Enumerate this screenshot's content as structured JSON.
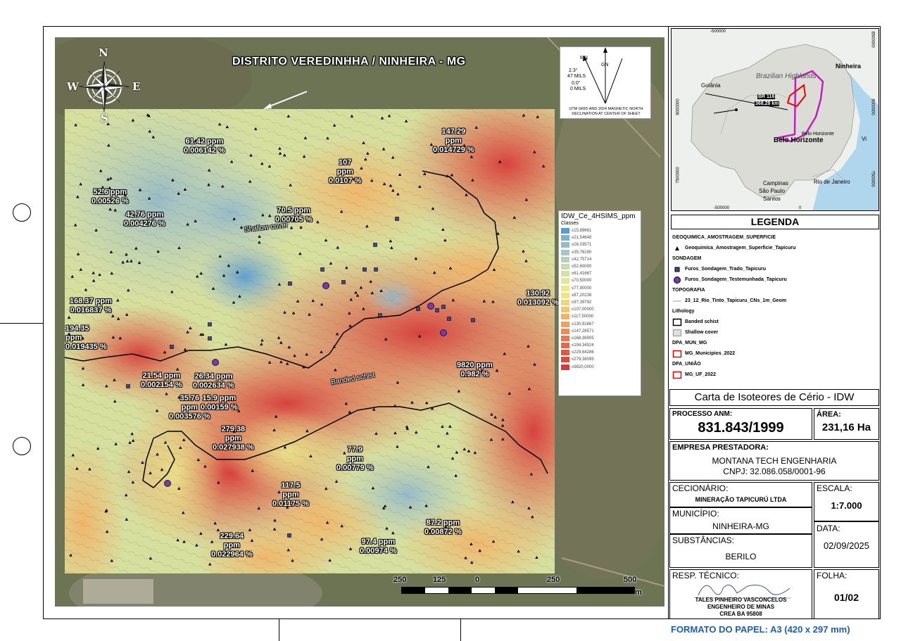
{
  "map": {
    "title": "DISTRITO VEREDINHHA / NINHEIRA - MG",
    "compass": {
      "n": "N",
      "s": "S",
      "e": "E",
      "w": "W"
    },
    "declination_text": [
      "UTM GRID AND 2024 MAGNETIC NORTH",
      "DECLINATION AT CENTER OF SHEET"
    ],
    "declination_marks": {
      "mn": "MN",
      "gn": "GN",
      "angle1": "2.3°",
      "mils": "47 MILS",
      "deg": "0.0°",
      "mils2": "0 MILS"
    },
    "geo_labels": [
      {
        "text": "Shallow cover"
      },
      {
        "text": "Banded schist"
      }
    ],
    "samples": [
      {
        "name": "61.42ppm",
        "lines": [
          "61.42 ppm",
          "0.006142 %"
        ]
      },
      {
        "name": "147.29ppm",
        "lines": [
          "147.29",
          "ppm",
          "0.014729 %"
        ]
      },
      {
        "name": "107ppm",
        "lines": [
          "107",
          "ppm",
          "0.0107 %"
        ]
      },
      {
        "name": "52.6ppm",
        "lines": [
          "52.6 ppm",
          "0.00526 %"
        ]
      },
      {
        "name": "42.76ppm",
        "lines": [
          "42.76 ppm",
          "0.004276 %"
        ]
      },
      {
        "name": "70.5ppm",
        "lines": [
          "70.5 ppm",
          "0.00705 %"
        ]
      },
      {
        "name": "168.37ppm",
        "lines": [
          "168.37 ppm",
          "0.016837 %"
        ]
      },
      {
        "name": "130.92ppm",
        "lines": [
          "130.92",
          "0.013092 %"
        ]
      },
      {
        "name": "194.35ppm",
        "lines": [
          "194.35",
          "ppm",
          "0.019435 %"
        ]
      },
      {
        "name": "9820ppm",
        "lines": [
          "9820 ppm",
          "0.982 %"
        ]
      },
      {
        "name": "21.54ppm",
        "lines": [
          "21.54 ppm",
          "0.002154 %"
        ]
      },
      {
        "name": "26.34ppm",
        "lines": [
          "26.34 ppm",
          "0.002634 %"
        ]
      },
      {
        "name": "35.76ppm",
        "lines": [
          "35.76",
          "ppm",
          "0.003576 %"
        ]
      },
      {
        "name": "15.9ppm",
        "lines": [
          "15.9 ppm",
          "0.00159 %"
        ]
      },
      {
        "name": "279.38ppm",
        "lines": [
          "279.38",
          "ppm",
          "0.027938 %"
        ]
      },
      {
        "name": "77.9ppm",
        "lines": [
          "77.9",
          "ppm",
          "0.00779 %"
        ]
      },
      {
        "name": "117.5ppm",
        "lines": [
          "117.5",
          "ppm",
          "0.01175 %"
        ]
      },
      {
        "name": "87.2ppm",
        "lines": [
          "87.2 ppm",
          "0.00872 %"
        ]
      },
      {
        "name": "229.64ppm",
        "lines": [
          "229.64",
          "ppm",
          "0.022964 %"
        ]
      },
      {
        "name": "97.4ppm",
        "lines": [
          "97.4 ppm",
          "0.00974 %"
        ]
      }
    ],
    "idw_legend": {
      "title": "IDW_Ce_4HSIMS_ppm",
      "subtitle": "Classes",
      "classes": [
        {
          "label": "≤15,89661",
          "color": "#5a9bd4"
        },
        {
          "label": "≤21,54648",
          "color": "#7fb0d2"
        },
        {
          "label": "≤26,03571",
          "color": "#95bccc"
        },
        {
          "label": "≤35,76190",
          "color": "#a8c6c6"
        },
        {
          "label": "≤42,75714",
          "color": "#b9d0bd"
        },
        {
          "label": "≤52,60000",
          "color": "#c9d9b2"
        },
        {
          "label": "≤61,41667",
          "color": "#d6e0a6"
        },
        {
          "label": "≤70,50000",
          "color": "#e2e698"
        },
        {
          "label": "≤77,90000",
          "color": "#ebe88c"
        },
        {
          "label": "≤87,20238",
          "color": "#f1e382"
        },
        {
          "label": "≤97,39792",
          "color": "#f3d679"
        },
        {
          "label": "≤107,00000",
          "color": "#f4c56f"
        },
        {
          "label": "≤117,50000",
          "color": "#f3b266"
        },
        {
          "label": "≤130,91667",
          "color": "#f09f5e"
        },
        {
          "label": "≤147,28571",
          "color": "#ec8c56"
        },
        {
          "label": "≤168,36905",
          "color": "#e87a4f"
        },
        {
          "label": "≤194,34524",
          "color": "#e46849"
        },
        {
          "label": "≤229,64286",
          "color": "#e05743"
        },
        {
          "label": "≤279,38095",
          "color": "#dc493e"
        },
        {
          "label": "≤9820,0000",
          "color": "#d83a39"
        }
      ]
    },
    "scale": {
      "ticks": [
        "250",
        "125",
        "0",
        "250",
        "500"
      ],
      "unit": "m"
    }
  },
  "inset": {
    "labels": {
      "ninheira": "Ninheira",
      "brazilian": "Brazilian Highlands",
      "goiania": "Goiânia",
      "br116": "BR 116",
      "dist": "368,28 km",
      "bh_small": "Belo Horizonte",
      "bh": "Belo Horizonte",
      "campinas": "Campinas",
      "sp": "São Paulo",
      "rio": "Rio de Janeiro",
      "santos": "Santos",
      "vi": "Vi"
    },
    "grid": {
      "top_left": "-500000",
      "top_right": "500000",
      "bottom_left": "-500000",
      "bottom_mid": "0",
      "left_mid": "8000000",
      "left_low": "7500000",
      "right_top": "8500000",
      "right_mid": "8000000",
      "right_low": "7500000"
    }
  },
  "legend": {
    "title": "LEGENDA",
    "groups": [
      {
        "head": "GEOQUIMICA_AMOSTRAGEM_SUPERFICIE",
        "items": [
          {
            "sym": "triangle",
            "text": "Geoquimica_Amostragem_Superficie_Tapicuru"
          }
        ]
      },
      {
        "head": "SONDAGEM",
        "items": [
          {
            "sym": "square",
            "text": "Furos_Sondagem_Trado_Tapicuru"
          },
          {
            "sym": "circle",
            "text": "Furos_Sondagem_Testemunhada_Tapicuru"
          }
        ]
      },
      {
        "head": "TOPOGRAFIA",
        "items": [
          {
            "sym": "line",
            "text": "23_12_Rio_Tinto_Tapicuru_CNs_1m_Geom"
          }
        ]
      },
      {
        "head": "Lithology",
        "items": [
          {
            "sym": "box-black",
            "text": "Banded schist"
          },
          {
            "sym": "box-grey",
            "text": "Shallow cover"
          }
        ]
      },
      {
        "head": "DPA_MUN_MG",
        "items": [
          {
            "sym": "box-red",
            "text": "MG_Municipios_2022"
          }
        ]
      },
      {
        "head": "DPA_UNIÃO",
        "items": [
          {
            "sym": "box-red",
            "text": "MG_UF_2022"
          }
        ]
      }
    ]
  },
  "title_block": {
    "map_title": "Carta de Isoteores de Cério - IDW",
    "processo_label": "PROCESSO ANM:",
    "processo": "831.843/1999",
    "area_label": "ÁREA:",
    "area": "231,16 Ha",
    "empresa_label": "EMPRESA PRESTADORA:",
    "empresa": "MONTANA TECH ENGENHARIA",
    "cnpj": "CNPJ: 32.086.058/0001-96",
    "cecionario_label": "CECIONÁRIO:",
    "cecionario": "MINERAÇÃO TAPICURÚ LTDA",
    "escala_label": "ESCALA:",
    "escala": "1:7.000",
    "municipio_label": "MUNICÍPIO:",
    "municipio": "NINHEIRA-MG",
    "data_label": "DATA:",
    "data": "02/09/2025",
    "substancias_label": "SUBSTÂNCIAS:",
    "substancias": "BERILO",
    "resp_label": "RESP. TÉCNICO:",
    "resp_name": "TALES PINHEIRO VASCONCELOS",
    "resp_title": "ENGENHEIRO DE MINAS",
    "resp_crea": "CREA BA 95808",
    "folha_label": "FOLHA:",
    "folha": "01/02",
    "formato": "FORMATO DO PAPEL: A3 (420 x 297 mm)"
  }
}
